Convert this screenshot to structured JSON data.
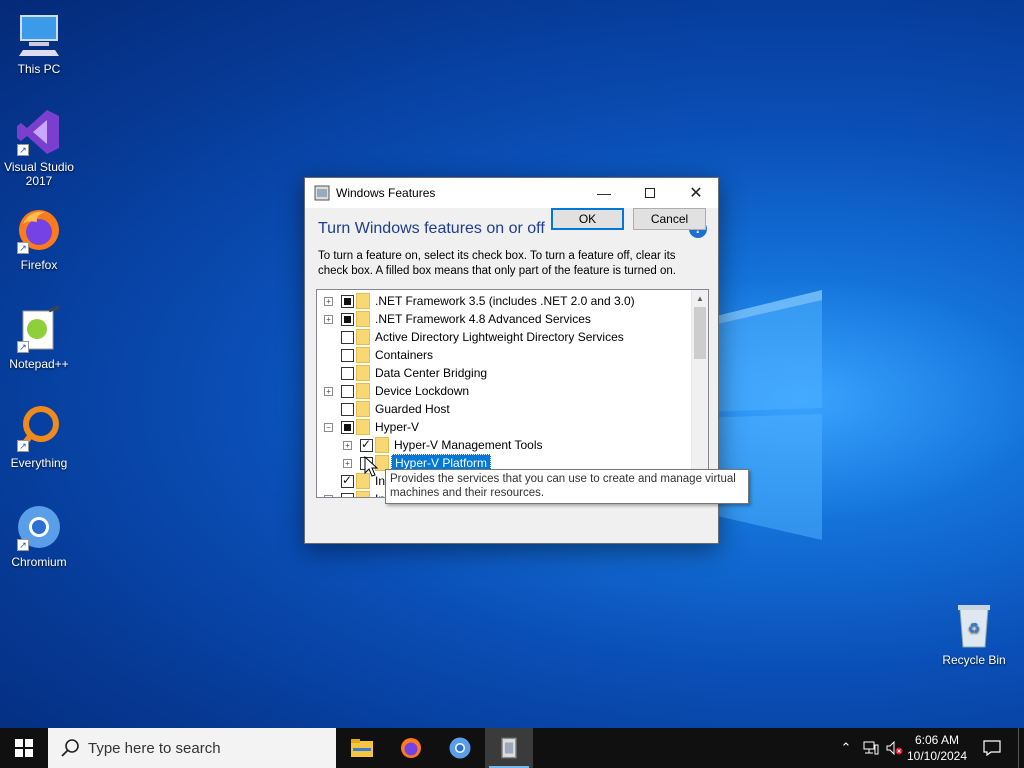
{
  "desktop": {
    "icons": [
      {
        "label": "This PC",
        "icon": "computer-icon"
      },
      {
        "label": "Visual Studio 2017",
        "icon": "visual-studio-icon"
      },
      {
        "label": "Firefox",
        "icon": "firefox-icon"
      },
      {
        "label": "Notepad++",
        "icon": "notepadpp-icon"
      },
      {
        "label": "Everything",
        "icon": "everything-icon"
      },
      {
        "label": "Chromium",
        "icon": "chromium-icon"
      },
      {
        "label": "Recycle Bin",
        "icon": "recycle-bin-icon"
      }
    ],
    "accent": "#0a4fb7"
  },
  "dialog": {
    "title": "Windows Features",
    "heading": "Turn Windows features on or off",
    "help_glyph": "?",
    "description": "To turn a feature on, select its check box. To turn a feature off, clear its check box. A filled box means that only part of the feature is turned on.",
    "features": [
      {
        "label": ".NET Framework 3.5 (includes .NET 2.0 and 3.0)",
        "expander": "+",
        "state": "partial"
      },
      {
        "label": ".NET Framework 4.8 Advanced Services",
        "expander": "+",
        "state": "partial"
      },
      {
        "label": "Active Directory Lightweight Directory Services",
        "expander": "",
        "state": "unchecked"
      },
      {
        "label": "Containers",
        "expander": "",
        "state": "unchecked"
      },
      {
        "label": "Data Center Bridging",
        "expander": "",
        "state": "unchecked"
      },
      {
        "label": "Device Lockdown",
        "expander": "+",
        "state": "unchecked"
      },
      {
        "label": "Guarded Host",
        "expander": "",
        "state": "unchecked"
      },
      {
        "label": "Hyper-V",
        "expander": "−",
        "state": "partial"
      },
      {
        "label": "Hyper-V Management Tools",
        "expander": "+",
        "state": "checked",
        "child": true
      },
      {
        "label": "Hyper-V Platform",
        "expander": "+",
        "state": "unchecked",
        "child": true,
        "selected": true
      },
      {
        "label": "In",
        "expander": "",
        "state": "checked"
      },
      {
        "label": "In",
        "expander": "+",
        "state": "unchecked"
      }
    ],
    "tooltip": "Provides the services that you can use to create and manage virtual machines and their resources.",
    "ok_label": "OK",
    "cancel_label": "Cancel",
    "selection_color": "#0078d7"
  },
  "taskbar": {
    "search_placeholder": "Type here to search",
    "apps": [
      "file-explorer-icon",
      "firefox-icon",
      "chromium-icon",
      "windows-features-icon"
    ],
    "time": "6:06 AM",
    "date": "10/10/2024"
  }
}
